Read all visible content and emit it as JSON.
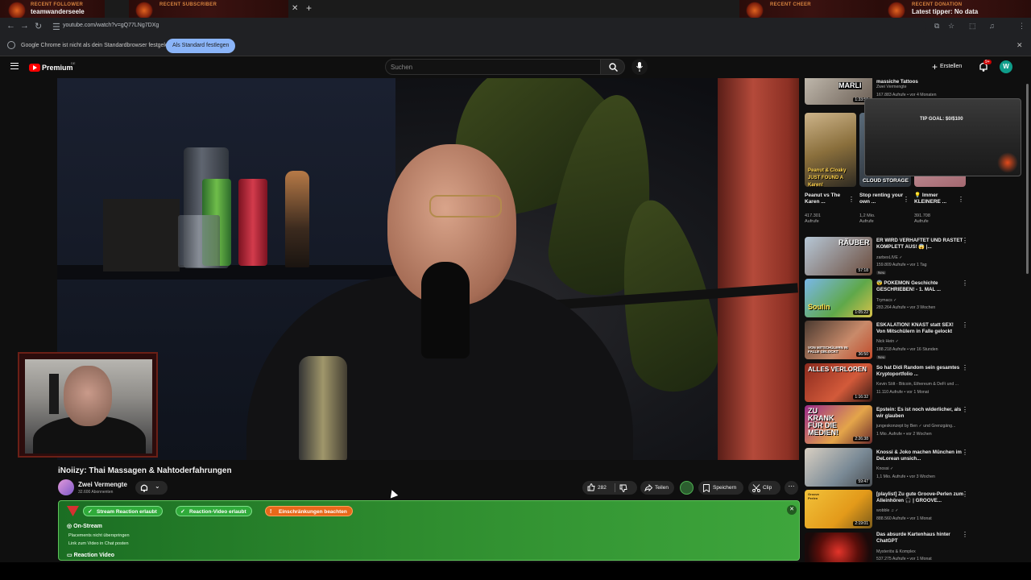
{
  "overlay": {
    "recent_follower": {
      "title": "RECENT FOLLOWER",
      "value": "teamwanderseele"
    },
    "recent_subscriber": {
      "title": "RECENT SUBSCRIBER",
      "value": ""
    },
    "recent_cheer": {
      "title": "RECENT CHEER",
      "value": ""
    },
    "recent_donation": {
      "title": "RECENT DONATION",
      "value": "Latest tipper: No data"
    },
    "tip_goal": "TIP GOAL: $0/$100"
  },
  "browser": {
    "url": "youtube.com/watch?v=gQ77LNg7DXg",
    "infobar_text": "Google Chrome ist nicht als dein Standardbrowser festgelegt",
    "infobar_button": "Als Standard festlegen"
  },
  "header": {
    "brand": "Premium",
    "country": "DE",
    "search_placeholder": "Suchen",
    "create_label": "Erstellen",
    "notif_badge": "9+",
    "avatar_letter": "W"
  },
  "video": {
    "title": "iNoiizy: Thai Massagen & Nahtoderfahrungen",
    "channel": "Zwei Vermengte",
    "subscribers": "32.600 Abonnenten",
    "likes": "282",
    "share_label": "Teilen",
    "save_label": "Speichern",
    "clip_label": "Clip"
  },
  "panel": {
    "badge1": "Stream Reaction erlaubt",
    "badge2": "Reaction-Video erlaubt",
    "badge3": "Einschränkungen beachten",
    "section1": "On-Stream",
    "line1": "Placements nicht überspringen",
    "line2": "Link zum Video in Chat posten",
    "section2": "Reaction Video"
  },
  "shorts": [
    {
      "title": "Peanut vs The Karen ...",
      "views": "417.301",
      "views_unit": "Aufrufe",
      "caption": "Peanut & Cloaky JUST FOUND A Karen!"
    },
    {
      "title": "Stop renting your own ...",
      "views": "1,2 Mio.",
      "views_unit": "Aufrufe",
      "caption": "CLOUD STORAGE"
    },
    {
      "title": "💡 Immer KLEINERE ...",
      "views": "391.708",
      "views_unit": "Aufrufe",
      "caption": ""
    }
  ],
  "top_partial": {
    "title": "massiche Tattoos",
    "channel": "Zwei Vermengte",
    "meta": "167.883 Aufrufe • vor 4 Monaten",
    "duration": "1:33:59",
    "caption": "MARLI"
  },
  "recommendations": [
    {
      "title": "ER WIRD VERHAFTET UND RASTET KOMPLETT AUS! 😱 |...",
      "channel": "zarbexLIVE ✓",
      "meta": "159.809 Aufrufe • vor 1 Tag",
      "badge": "Neu",
      "duration": "57:18",
      "caption": "RÄUBER"
    },
    {
      "title": "😨 POKEMON Geschichte GESCHRIEBEN! - 1. MAL ...",
      "channel": "Trymacs ✓",
      "meta": "283.264 Aufrufe • vor 3 Wochen",
      "badge": "",
      "duration": "1:05:22",
      "caption": "Soulin"
    },
    {
      "title": "ESKALATION! KNAST statt SEX! Von Mitschülern in Falle gelockt",
      "channel": "Nick Hein ✓",
      "meta": "188.218 Aufrufe • vor 16 Stunden",
      "badge": "Neu",
      "duration": "36:50",
      "caption": "VON MITSCHÜLERN IN FALLE GELOCKT"
    },
    {
      "title": "So hat Didi Random sein gesamtes Kryptoportfolio ...",
      "channel": "Kevin Sölt - Bitcoin, Ethereum & DeFi und ...",
      "meta": "11.110 Aufrufe • vor 1 Monat",
      "badge": "",
      "duration": "1:16:32",
      "caption": "ALLES VERLOREN"
    },
    {
      "title": "Epstein: Es ist noch widerlicher, als wir glauben",
      "channel": "jungeskonzept by Ben ✓ und Grenzgäng...",
      "meta": "1 Mio. Aufrufe • vor 2 Wochen",
      "badge": "",
      "duration": "2:26:38",
      "caption": "ZU KRANK FÜR DIE MEDIEN!"
    },
    {
      "title": "Knossi & Joko machen München im DeLorean unsich...",
      "channel": "Knossi ✓",
      "meta": "1,1 Mio. Aufrufe • vor 3 Wochen",
      "badge": "",
      "duration": "59:47",
      "caption": ""
    },
    {
      "title": "[playlist] Zu gute Groove-Perlen zum Alleinhören 🎧 | GROOVE...",
      "channel": "wobble ♫ ✓",
      "meta": "888.560 Aufrufe • vor 1 Monat",
      "badge": "",
      "duration": "2:19:01",
      "caption": "Groove Perlen"
    },
    {
      "title": "Das absurde Kartenhaus hinter ChatGPT",
      "channel": "Mysteriös & Komplex",
      "meta": "537.275 Aufrufe • vor 1 Monat",
      "badge": "",
      "duration": "",
      "caption": ""
    }
  ]
}
